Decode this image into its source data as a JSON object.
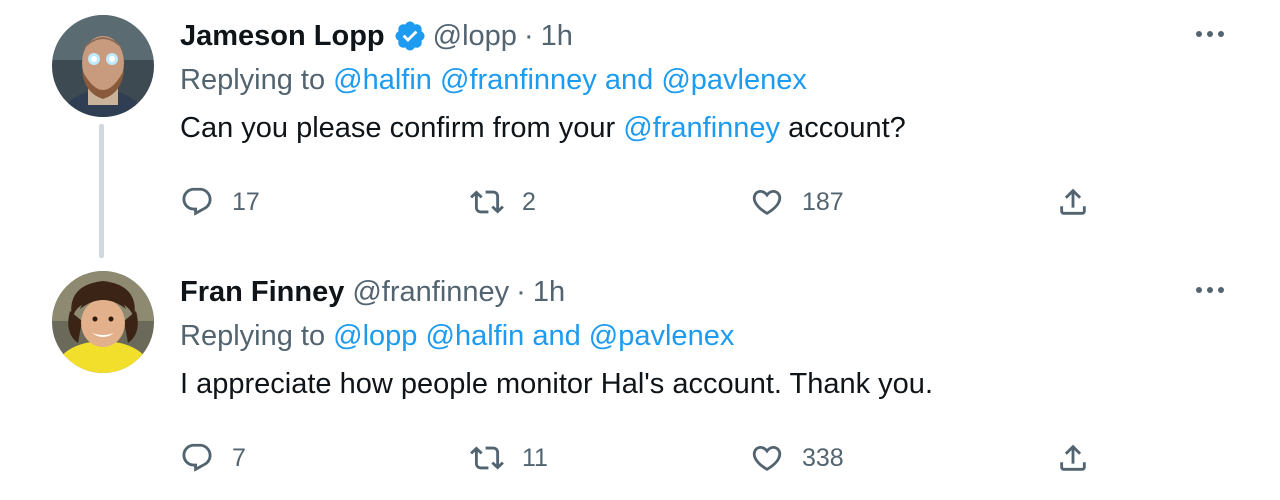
{
  "tweets": [
    {
      "display_name": "Jameson Lopp",
      "verified": true,
      "handle": "@lopp",
      "separator": "·",
      "time": "1h",
      "replying_prefix": "Replying to",
      "replying_mentions": [
        "@halfin",
        "@franfinney"
      ],
      "replying_and": "and",
      "replying_last": "@pavlenex",
      "text_before": "Can you please confirm from your",
      "text_mention": "@franfinney",
      "text_after": "account?",
      "reply_count": "17",
      "retweet_count": "2",
      "like_count": "187"
    },
    {
      "display_name": "Fran Finney",
      "verified": false,
      "handle": "@franfinney",
      "separator": "·",
      "time": "1h",
      "replying_prefix": "Replying to",
      "replying_mentions": [
        "@lopp",
        "@halfin"
      ],
      "replying_and": "and",
      "replying_last": "@pavlenex",
      "text": "I appreciate how people monitor Hal's account. Thank you.",
      "reply_count": "7",
      "retweet_count": "11",
      "like_count": "338"
    }
  ],
  "icons": {
    "reply": "speech-bubble-icon",
    "retweet": "retweet-arrows-icon",
    "like": "heart-icon",
    "share": "share-upload-icon",
    "more": "more-dots-icon",
    "verified": "verified-badge-icon"
  },
  "colors": {
    "accent": "#1d9bf0",
    "secondary_text": "#536471",
    "primary_text": "#0f1419",
    "thread_line": "#cfd9de"
  }
}
